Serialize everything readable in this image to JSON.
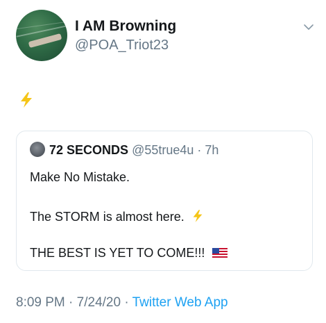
{
  "author": {
    "display_name": "I AM Browning",
    "handle": "@POA_Triot23"
  },
  "tweet": {
    "body_emoji": "zap-emoji"
  },
  "quoted_tweet": {
    "display_name": "72 SECONDS",
    "handle": "@55true4u",
    "separator": " · ",
    "time": "7h",
    "lines": [
      "Make No Mistake.",
      "The STORM is almost here.",
      "THE BEST IS YET TO COME!!!"
    ]
  },
  "meta": {
    "time": "8:09 PM",
    "separator1": " · ",
    "date": "7/24/20",
    "separator2": " · ",
    "app": "Twitter Web App"
  },
  "colors": {
    "text_primary": "#14171a",
    "text_secondary": "#657786",
    "link": "#1da1f2",
    "border": "#e1e8ed",
    "zap": "#f5c518"
  }
}
